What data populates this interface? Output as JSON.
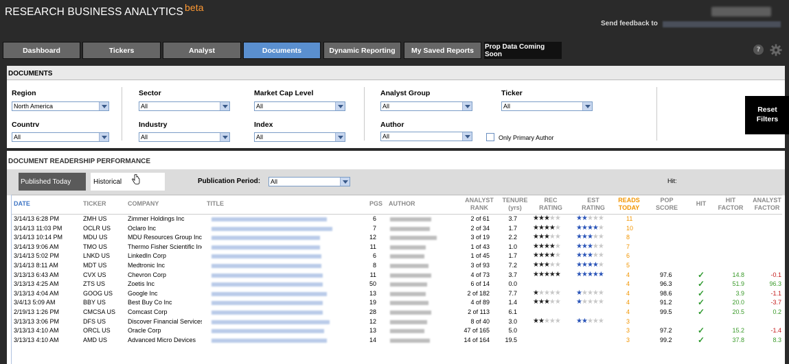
{
  "header": {
    "title": "RESEARCH BUSINESS ANALYTICS",
    "beta": "beta",
    "feedback": "Send feedback to"
  },
  "tabs": [
    {
      "label": "Dashboard"
    },
    {
      "label": "Tickers"
    },
    {
      "label": "Analyst"
    },
    {
      "label": "Documents"
    },
    {
      "label": "Dynamic Reporting"
    },
    {
      "label": "My Saved Reports"
    },
    {
      "label": "Prop Data Coming Soon"
    }
  ],
  "documents": {
    "section_title": "DOCUMENTS",
    "filters": {
      "region": {
        "label": "Region",
        "value": "North America"
      },
      "country": {
        "label": "Countrv",
        "value": "All"
      },
      "sector": {
        "label": "Sector",
        "value": "All"
      },
      "industry": {
        "label": "Industry",
        "value": "All"
      },
      "market_cap": {
        "label": "Market Cap Level",
        "value": "All"
      },
      "index": {
        "label": "Index",
        "value": "All"
      },
      "analyst_group": {
        "label": "Analyst Group",
        "value": "All"
      },
      "author": {
        "label": "Author",
        "value": "All"
      },
      "ticker": {
        "label": "Ticker",
        "value": "All"
      },
      "only_primary_author": {
        "label": "Only Primary Author",
        "checked": false
      }
    },
    "reset_line1": "Reset",
    "reset_line2": "Filters"
  },
  "performance": {
    "section_title": "DOCUMENT READERSHIP PERFORMANCE",
    "tab_published": "Published Today",
    "tab_historical": "Historical",
    "publication_period_label": "Publication Period:",
    "publication_period_value": "All",
    "hit_label": "Hit:",
    "columns": {
      "date": "DATE",
      "ticker": "TICKER",
      "company": "COMPANY",
      "title": "TITLE",
      "pgs": "PGS",
      "author": "AUTHOR",
      "analyst_rank": [
        "ANALYST",
        "RANK"
      ],
      "tenure": [
        "TENURE",
        "(yrs)"
      ],
      "rec_rating": [
        "REC",
        "RATING"
      ],
      "est_rating": [
        "EST",
        "RATING"
      ],
      "reads_today": [
        "READS",
        "TODAY"
      ],
      "pop_score": [
        "POP",
        "SCORE"
      ],
      "hit": "HIT",
      "hit_factor": [
        "HIT",
        "FACTOR"
      ],
      "analyst_factor": [
        "ANALYST",
        "FACTOR"
      ]
    },
    "rows": [
      {
        "date": "3/14/13 6:28 PM",
        "ticker": "ZMH US",
        "company": "Zimmer Holdings Inc",
        "pgs": "6",
        "rank": "2 of 61",
        "tenure": "3.7",
        "rec": 3,
        "est": 2,
        "reads": "11",
        "pop": "",
        "hit": false,
        "hit_factor": "",
        "analyst_factor": "",
        "af_color": ""
      },
      {
        "date": "3/14/13 11:03 PM",
        "ticker": "OCLR US",
        "company": "Oclaro Inc",
        "pgs": "7",
        "rank": "2 of 34",
        "tenure": "1.7",
        "rec": 4,
        "est": 4,
        "reads": "10",
        "pop": "",
        "hit": false,
        "hit_factor": "",
        "analyst_factor": "",
        "af_color": ""
      },
      {
        "date": "3/14/13 10:14 PM",
        "ticker": "MDU US",
        "company": "MDU Resources Group Inc",
        "pgs": "12",
        "rank": "3 of 19",
        "tenure": "2.2",
        "rec": 3,
        "est": 3,
        "reads": "8",
        "pop": "",
        "hit": false,
        "hit_factor": "",
        "analyst_factor": "",
        "af_color": ""
      },
      {
        "date": "3/14/13 9:06 AM",
        "ticker": "TMO US",
        "company": "Thermo Fisher Scientific Inc",
        "pgs": "11",
        "rank": "1 of 43",
        "tenure": "1.0",
        "rec": 4,
        "est": 3,
        "reads": "7",
        "pop": "",
        "hit": false,
        "hit_factor": "",
        "analyst_factor": "",
        "af_color": ""
      },
      {
        "date": "3/14/13 5:02 PM",
        "ticker": "LNKD US",
        "company": "LinkedIn Corp",
        "pgs": "6",
        "rank": "1 of 45",
        "tenure": "1.7",
        "rec": 4,
        "est": 3,
        "reads": "6",
        "pop": "",
        "hit": false,
        "hit_factor": "",
        "analyst_factor": "",
        "af_color": ""
      },
      {
        "date": "3/14/13 8:11 AM",
        "ticker": "MDT US",
        "company": "Medtronic Inc",
        "pgs": "8",
        "rank": "3 of 93",
        "tenure": "7.2",
        "rec": 3,
        "est": 4,
        "reads": "5",
        "pop": "",
        "hit": false,
        "hit_factor": "",
        "analyst_factor": "",
        "af_color": ""
      },
      {
        "date": "3/13/13 6:43 AM",
        "ticker": "CVX US",
        "company": "Chevron Corp",
        "pgs": "11",
        "rank": "4 of 73",
        "tenure": "3.7",
        "rec": 5,
        "est": 5,
        "reads": "4",
        "pop": "97.6",
        "hit": true,
        "hit_factor": "14.8",
        "analyst_factor": "-0.1",
        "af_color": "red"
      },
      {
        "date": "3/13/13 4:25 AM",
        "ticker": "ZTS US",
        "company": "Zoetis Inc",
        "pgs": "50",
        "rank": "6 of 14",
        "tenure": "0.0",
        "rec": 0,
        "est": 0,
        "reads": "4",
        "pop": "96.3",
        "hit": true,
        "hit_factor": "51.9",
        "analyst_factor": "96.3",
        "af_color": "green"
      },
      {
        "date": "3/13/13 4:04 AM",
        "ticker": "GOOG US",
        "company": "Google Inc",
        "pgs": "13",
        "rank": "2 of 182",
        "tenure": "7.7",
        "rec": 1,
        "est": 1,
        "reads": "4",
        "pop": "98.6",
        "hit": true,
        "hit_factor": "3.9",
        "analyst_factor": "-1.1",
        "af_color": "red"
      },
      {
        "date": "3/4/13 5:09 AM",
        "ticker": "BBY US",
        "company": "Best Buy Co Inc",
        "pgs": "19",
        "rank": "4 of 89",
        "tenure": "1.4",
        "rec": 3,
        "est": 1,
        "reads": "4",
        "pop": "91.2",
        "hit": true,
        "hit_factor": "20.0",
        "analyst_factor": "-3.7",
        "af_color": "red"
      },
      {
        "date": "2/19/13 1:26 PM",
        "ticker": "CMCSA US",
        "company": "Comcast Corp",
        "pgs": "28",
        "rank": "2 of 113",
        "tenure": "6.1",
        "rec": 0,
        "est": 0,
        "reads": "4",
        "pop": "99.5",
        "hit": true,
        "hit_factor": "20.5",
        "analyst_factor": "0.2",
        "af_color": "green"
      },
      {
        "date": "3/13/13 3:06 PM",
        "ticker": "DFS US",
        "company": "Discover Financial Services",
        "pgs": "12",
        "rank": "8 of 40",
        "tenure": "3.0",
        "rec": 2,
        "est": 2,
        "reads": "3",
        "pop": "",
        "hit": false,
        "hit_factor": "",
        "analyst_factor": "",
        "af_color": ""
      },
      {
        "date": "3/13/13 4:10 AM",
        "ticker": "ORCL US",
        "company": "Oracle Corp",
        "pgs": "13",
        "rank": "47 of 165",
        "tenure": "5.0",
        "rec": 0,
        "est": 0,
        "reads": "3",
        "pop": "97.2",
        "hit": true,
        "hit_factor": "15.2",
        "analyst_factor": "-1.4",
        "af_color": "red"
      },
      {
        "date": "3/13/13 4:10 AM",
        "ticker": "AMD US",
        "company": "Advanced Micro Devices",
        "pgs": "14",
        "rank": "14 of 164",
        "tenure": "19.5",
        "rec": 0,
        "est": 0,
        "reads": "3",
        "pop": "99.2",
        "hit": true,
        "hit_factor": "37.8",
        "analyst_factor": "8.3",
        "af_color": "green"
      }
    ]
  },
  "colors": {
    "accent": "#5a8fcf",
    "header_bg": "#2a2a2a",
    "reads_orange": "#f29500",
    "positive": "#3a9a2a",
    "negative": "#c41818"
  },
  "icons": [
    "help-icon",
    "gear-icon",
    "dropdown-arrow-icon",
    "pointer-cursor-icon",
    "checkmark-icon",
    "star-icon"
  ]
}
